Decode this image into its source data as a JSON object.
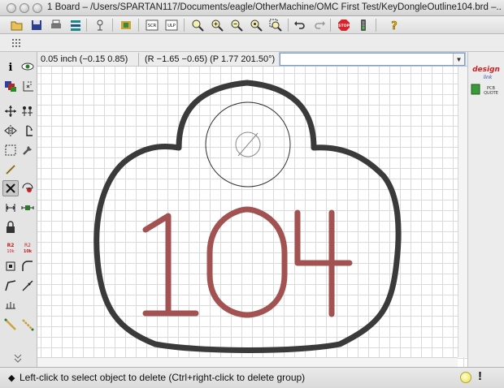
{
  "window": {
    "title": "1 Board – /Users/SPARTAN117/Documents/eagle/OtherMachine/OMC First Test/KeyDongleOutline104.brd –..."
  },
  "coords": {
    "grid_readout": "0.05 inch (−0.15 0.85)",
    "polar_readout": "(R −1.65 −0.65) (P 1.77 201.50°)",
    "command_value": ""
  },
  "status": {
    "message": "Left-click to select object to delete (Ctrl+right-click to delete group)"
  },
  "toolbar_icons": [
    "open-icon",
    "save-icon",
    "print-icon",
    "cam-processor-icon",
    "ulp-icon",
    "script-icon",
    "scr-icon",
    "ulp-run-icon",
    "zoom-fit-icon",
    "zoom-in-icon",
    "zoom-out-icon",
    "zoom-redraw-icon",
    "zoom-select-icon",
    "undo-icon",
    "redo-icon",
    "stop-icon",
    "go-icon",
    "help-icon"
  ],
  "right_panel": {
    "logo_line1": "design",
    "logo_line2": "link",
    "quote_line1": "PCB",
    "quote_line2": "QUOTE"
  },
  "board": {
    "label_text": "104",
    "outline_color": "#3a3a3a",
    "text_color": "#a35252"
  }
}
